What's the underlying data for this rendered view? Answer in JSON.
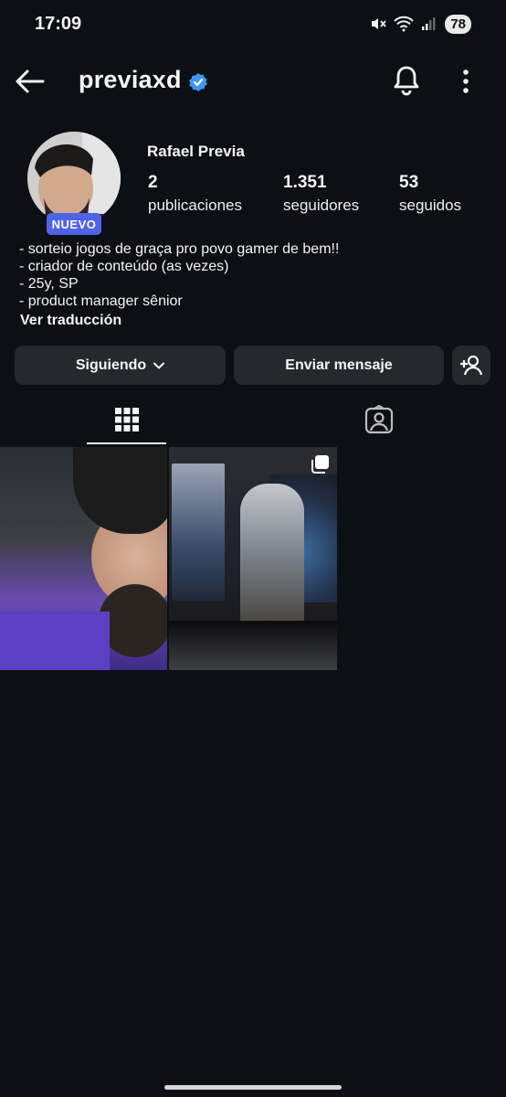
{
  "status": {
    "time": "17:09",
    "battery": "78"
  },
  "header": {
    "username": "previaxd"
  },
  "profile": {
    "badge": "NUEVO",
    "full_name": "Rafael Previa",
    "stats": [
      {
        "value": "2",
        "label": "publicaciones"
      },
      {
        "value": "1.351",
        "label": "seguidores"
      },
      {
        "value": "53",
        "label": "seguidos"
      }
    ],
    "bio": [
      "- sorteio jogos de graça pro povo gamer de bem!!",
      "- criador de conteúdo (as vezes)",
      "- 25y, SP",
      "- product manager sênior"
    ],
    "translate_label": "Ver traducción"
  },
  "actions": {
    "following_label": "Siguiendo",
    "message_label": "Enviar mensaje"
  },
  "icons": {
    "back": "arrow-left-icon",
    "verified": "verified-badge-icon",
    "bell": "bell-icon",
    "more": "more-vertical-icon",
    "grid": "grid-icon",
    "tagged": "tagged-person-icon",
    "add_person": "add-person-icon",
    "multi": "multiple-photos-icon"
  },
  "colors": {
    "background": "#0c0f14",
    "button": "#25292f",
    "badge": "#4f63e9",
    "verified": "#3b97f3"
  }
}
